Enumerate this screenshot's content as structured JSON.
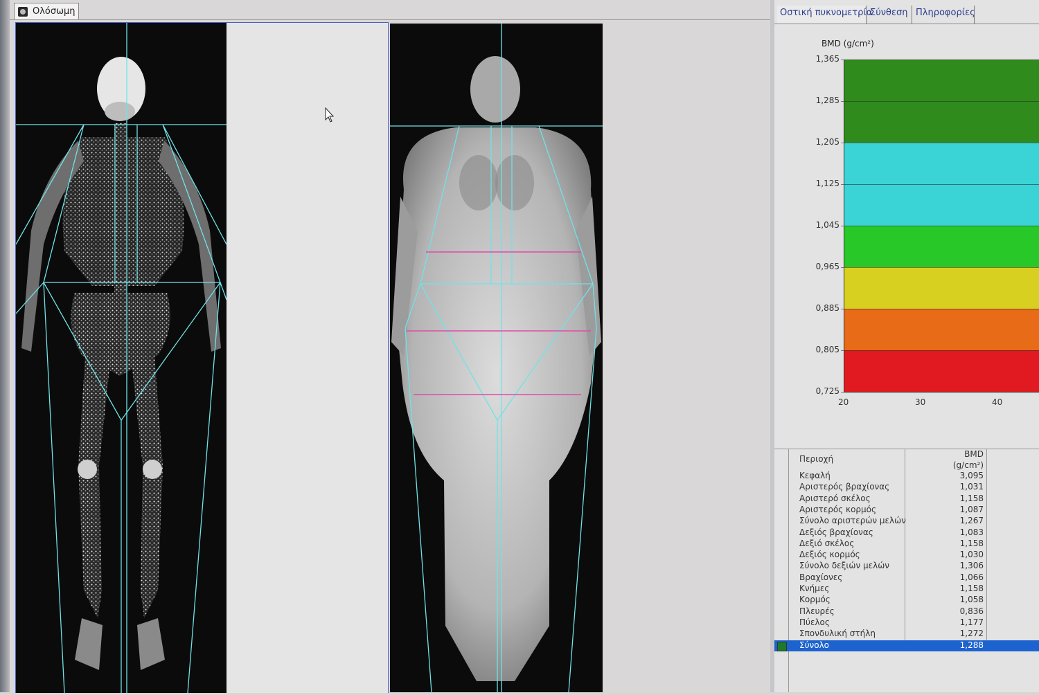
{
  "window": {
    "title": "Ολόσωμη"
  },
  "tabs": [
    {
      "label": "Οστική πυκνομετρία",
      "active": true
    },
    {
      "label": "Σύνθεση",
      "active": false
    },
    {
      "label": "Πληροφορίες",
      "active": false
    }
  ],
  "chart_data": {
    "type": "area",
    "ylabel": "BMD (g/cm²)",
    "y_ticks": [
      "1,365",
      "1,285",
      "1,205",
      "1,125",
      "1,045",
      "0,965",
      "0,885",
      "0,805",
      "0,725"
    ],
    "ylim": [
      0.725,
      1.365
    ],
    "x_ticks": [
      "20",
      "30",
      "40"
    ],
    "bands": [
      {
        "from": 1.205,
        "to": 1.365,
        "color": "#2f8c1c"
      },
      {
        "from": 1.045,
        "to": 1.205,
        "color": "#3ad3d6"
      },
      {
        "from": 0.965,
        "to": 1.045,
        "color": "#28c828"
      },
      {
        "from": 0.885,
        "to": 0.965,
        "color": "#d8d020"
      },
      {
        "from": 0.805,
        "to": 0.885,
        "color": "#e86c18"
      },
      {
        "from": 0.725,
        "to": 0.805,
        "color": "#e01a20"
      }
    ]
  },
  "table": {
    "header_region": "Περιοχή",
    "header_bmd": "BMD",
    "header_unit": "(g/cm²)",
    "rows": [
      {
        "name": "Κεφαλή",
        "value": "3,095"
      },
      {
        "name": "Αριστερός βραχίονας",
        "value": "1,031"
      },
      {
        "name": "Αριστερό σκέλος",
        "value": "1,158"
      },
      {
        "name": "Αριστερός κορμός",
        "value": "1,087"
      },
      {
        "name": "Σύνολο αριστερών μελών",
        "value": "1,267"
      },
      {
        "name": "Δεξιός βραχίονας",
        "value": "1,083"
      },
      {
        "name": "Δεξιό σκέλος",
        "value": "1,158"
      },
      {
        "name": "Δεξιός κορμός",
        "value": "1,030"
      },
      {
        "name": "Σύνολο δεξιών μελών",
        "value": "1,306"
      },
      {
        "name": "Βραχίονες",
        "value": "1,066"
      },
      {
        "name": "Κνήμες",
        "value": "1,158"
      },
      {
        "name": "Κορμός",
        "value": "1,058"
      },
      {
        "name": "Πλευρές",
        "value": "0,836"
      },
      {
        "name": "Πύελος",
        "value": "1,177"
      },
      {
        "name": "Σπονδυλική στήλη",
        "value": "1,272"
      },
      {
        "name": "Σύνολο",
        "value": "1,288",
        "selected": true,
        "swatch": "#1c7a2a"
      }
    ]
  }
}
